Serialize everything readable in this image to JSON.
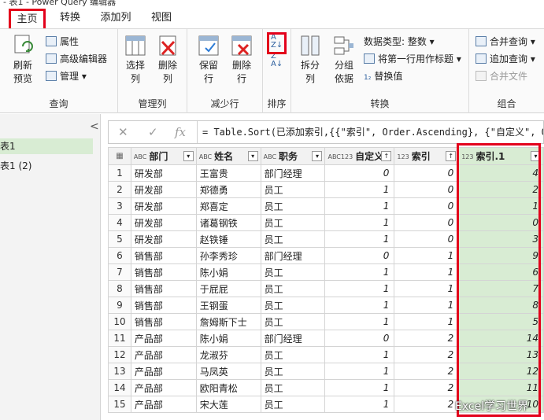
{
  "window": {
    "title_partial": "- 表1 - Power Query 编辑器"
  },
  "tabs": [
    "主页",
    "转换",
    "添加列",
    "视图"
  ],
  "ribbon": {
    "groups": [
      "查询",
      "管理列",
      "减少行",
      "排序",
      "转换",
      "组合"
    ],
    "refresh": "刷新\n预览",
    "properties": "属性",
    "advanced_editor": "高级编辑器",
    "manage": "管理",
    "choose_columns": "选择\n列",
    "remove_columns": "删除\n列",
    "keep_rows": "保留\n行",
    "remove_rows": "删除\n行",
    "split_column": "拆分\n列",
    "group_by": "分组\n依据",
    "data_type": "数据类型: 整数",
    "use_first_row": "将第一行用作标题",
    "replace_values": "替换值",
    "merge_queries": "合并查询",
    "append_queries": "追加查询",
    "combine_files": "合并文件"
  },
  "queries_panel": {
    "items": [
      "表1",
      "表1 (2)"
    ],
    "collapse": "<"
  },
  "formula_bar": {
    "cancel": "✕",
    "confirm": "✓",
    "fx": "fx",
    "formula": "= Table.Sort(已添加索引,{{\"索引\", Order.Ascending}, {\"自定义\", Order"
  },
  "grid": {
    "columns": [
      {
        "type": "ABC",
        "name": "部门"
      },
      {
        "type": "ABC",
        "name": "姓名"
      },
      {
        "type": "ABC",
        "name": "职务"
      },
      {
        "type": "ABC123",
        "name": "自定义"
      },
      {
        "type": "123",
        "name": "索引"
      },
      {
        "type": "123",
        "name": "索引.1"
      }
    ],
    "rows": [
      [
        "1",
        "研发部",
        "王富贵",
        "部门经理",
        "0",
        "0",
        "4"
      ],
      [
        "2",
        "研发部",
        "郑德勇",
        "员工",
        "1",
        "0",
        "2"
      ],
      [
        "3",
        "研发部",
        "郑喜定",
        "员工",
        "1",
        "0",
        "1"
      ],
      [
        "4",
        "研发部",
        "诸葛钢铁",
        "员工",
        "1",
        "0",
        "0"
      ],
      [
        "5",
        "研发部",
        "赵铁锤",
        "员工",
        "1",
        "0",
        "3"
      ],
      [
        "6",
        "销售部",
        "孙李秀珍",
        "部门经理",
        "0",
        "1",
        "9"
      ],
      [
        "7",
        "销售部",
        "陈小娟",
        "员工",
        "1",
        "1",
        "6"
      ],
      [
        "8",
        "销售部",
        "于屁屁",
        "员工",
        "1",
        "1",
        "7"
      ],
      [
        "9",
        "销售部",
        "王钢蛋",
        "员工",
        "1",
        "1",
        "8"
      ],
      [
        "10",
        "销售部",
        "詹姆斯下士",
        "员工",
        "1",
        "1",
        "5"
      ],
      [
        "11",
        "产品部",
        "陈小娟",
        "部门经理",
        "0",
        "2",
        "14"
      ],
      [
        "12",
        "产品部",
        "龙淑芬",
        "员工",
        "1",
        "2",
        "13"
      ],
      [
        "13",
        "产品部",
        "马凤英",
        "员工",
        "1",
        "2",
        "12"
      ],
      [
        "14",
        "产品部",
        "欧阳青松",
        "员工",
        "1",
        "2",
        "11"
      ],
      [
        "15",
        "产品部",
        "宋大莲",
        "员工",
        "1",
        "2",
        "10"
      ]
    ]
  },
  "watermark": "Excel学习世界",
  "colors": {
    "highlight_border": "#e3001b",
    "selected_column": "#d8ecd3"
  }
}
